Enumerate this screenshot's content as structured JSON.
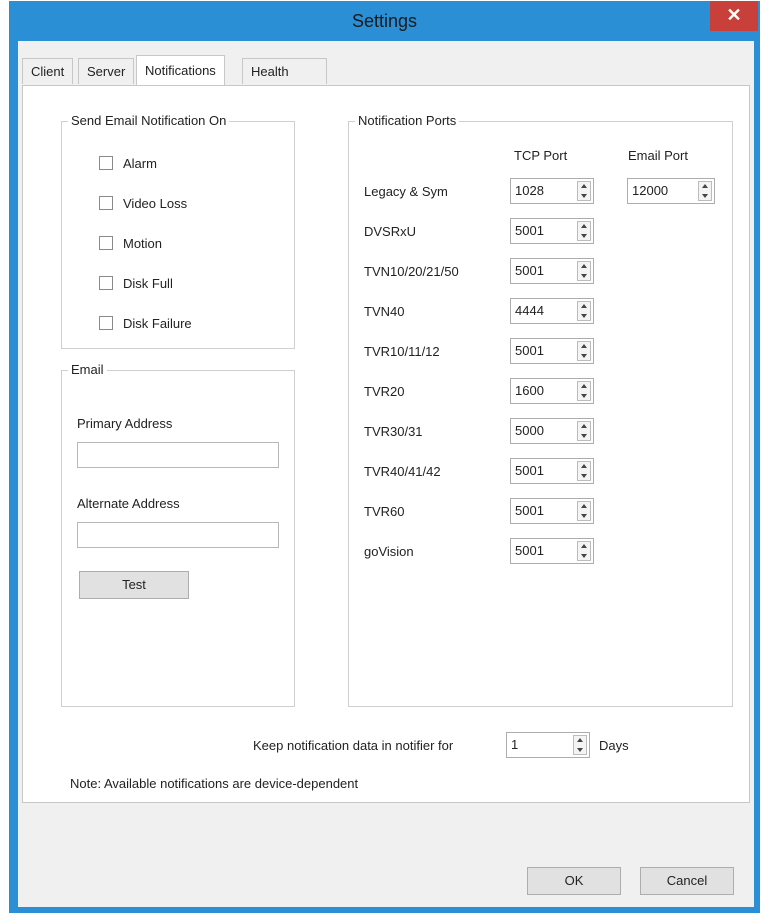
{
  "window": {
    "title": "Settings",
    "close_label": "✕"
  },
  "tabs": [
    {
      "label": "Client"
    },
    {
      "label": "Server"
    },
    {
      "label": "Notifications"
    },
    {
      "label": "Health Diagnostics"
    }
  ],
  "email_notification": {
    "legend": "Send Email Notification On",
    "options": [
      {
        "label": "Alarm",
        "checked": false
      },
      {
        "label": "Video Loss",
        "checked": false
      },
      {
        "label": "Motion",
        "checked": false
      },
      {
        "label": "Disk Full",
        "checked": false
      },
      {
        "label": "Disk Failure",
        "checked": false
      }
    ]
  },
  "email": {
    "legend": "Email",
    "primary_label": "Primary Address",
    "primary_value": "",
    "alternate_label": "Alternate Address",
    "alternate_value": "",
    "test_button": "Test"
  },
  "ports": {
    "legend": "Notification Ports",
    "tcp_header": "TCP Port",
    "email_header": "Email Port",
    "rows": [
      {
        "device": "Legacy & Sym",
        "tcp": "1028",
        "email": "12000"
      },
      {
        "device": "DVSRxU",
        "tcp": "5001"
      },
      {
        "device": "TVN10/20/21/50",
        "tcp": "5001"
      },
      {
        "device": "TVN40",
        "tcp": "4444"
      },
      {
        "device": "TVR10/11/12",
        "tcp": "5001"
      },
      {
        "device": "TVR20",
        "tcp": "1600"
      },
      {
        "device": "TVR30/31",
        "tcp": "5000"
      },
      {
        "device": "TVR40/41/42",
        "tcp": "5001"
      },
      {
        "device": "TVR60",
        "tcp": "5001"
      },
      {
        "device": "goVision",
        "tcp": "5001"
      }
    ]
  },
  "retention": {
    "label": "Keep notification data in notifier for",
    "value": "1",
    "unit": "Days"
  },
  "note": "Note: Available notifications are device-dependent",
  "footer": {
    "ok": "OK",
    "cancel": "Cancel"
  },
  "colors": {
    "titlebar": "#2b8fd6",
    "close": "#c9403a"
  }
}
